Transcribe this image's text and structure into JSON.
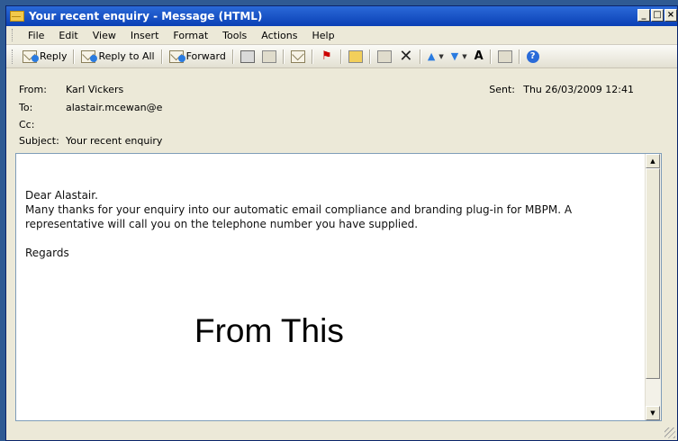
{
  "window": {
    "title": "Your recent enquiry - Message (HTML)",
    "controls": {
      "minimize": "_",
      "maximize": "□",
      "close": "×"
    }
  },
  "menu": [
    "File",
    "Edit",
    "View",
    "Insert",
    "Format",
    "Tools",
    "Actions",
    "Help"
  ],
  "toolbar": {
    "reply_label": "Reply",
    "reply_all_label": "Reply to All",
    "forward_label": "Forward"
  },
  "header": {
    "from_label": "From:",
    "from_value": "Karl Vickers",
    "sent_label": "Sent:",
    "sent_value": "Thu 26/03/2009 12:41",
    "to_label": "To:",
    "to_value": "alastair.mcewan@e",
    "cc_label": "Cc:",
    "cc_value": "",
    "subject_label": "Subject:",
    "subject_value": "Your recent enquiry"
  },
  "body": {
    "greeting": "Dear Alastair.",
    "paragraph": "Many thanks for your enquiry into our automatic email compliance and branding plug-in for MBPM. A representative will call you on the telephone number you have supplied.",
    "signoff": "Regards"
  },
  "overlay": {
    "text": "From This"
  },
  "colors": {
    "titlebar": "#0a3fb5",
    "desktop": "#2f5a93",
    "chrome": "#ece9d8"
  },
  "icons": [
    "envelope-icon",
    "reply-icon",
    "reply-all-icon",
    "forward-icon",
    "print-icon",
    "copy-icon",
    "move-icon",
    "flag-icon",
    "open-folder-icon",
    "address-book-icon",
    "delete-icon",
    "previous-icon",
    "next-icon",
    "font-size-icon",
    "translate-icon",
    "help-icon"
  ]
}
